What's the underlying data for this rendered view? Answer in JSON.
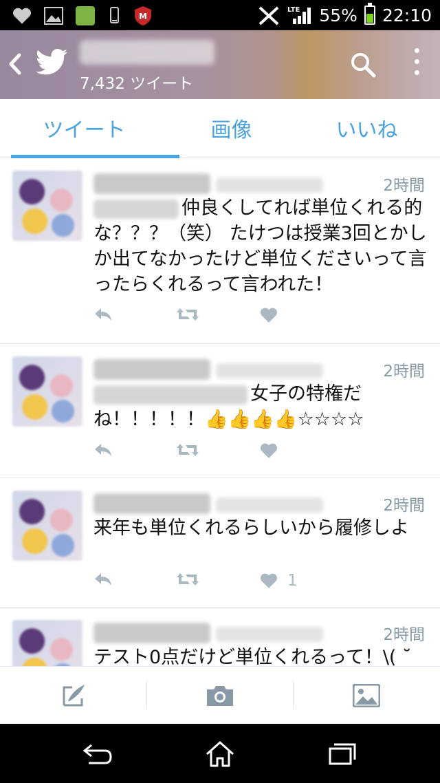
{
  "status_bar": {
    "battery": "55%",
    "time": "22:10",
    "network": "LTE",
    "icons": [
      "heart-icon",
      "gallery-icon",
      "app-icon",
      "phone-icon",
      "mcafee-icon",
      "mute-icon",
      "signal-icon",
      "battery-icon"
    ]
  },
  "header": {
    "tweet_count": "7,432 ツイート"
  },
  "tabs": [
    {
      "label": "ツイート",
      "active": true
    },
    {
      "label": "画像",
      "active": false
    },
    {
      "label": "いいね",
      "active": false
    }
  ],
  "tweets": [
    {
      "time": "2時間",
      "text": "仲良くしてれば単位くれる的な？？？（笑） たけつは授業3回とかしか出てなかったけど単位くださいって言ったらくれるって言われた！",
      "likes": ""
    },
    {
      "time": "2時間",
      "text": "女子の特権だね！！！！！👍👍👍👍☆☆☆☆",
      "likes": ""
    },
    {
      "time": "2時間",
      "text": "来年も単位くれるらしいから履修しよ",
      "likes": "1"
    },
    {
      "time": "2時間",
      "text": "テスト0点だけど単位くれるって！\\( ˘",
      "likes": ""
    }
  ],
  "colors": {
    "accent": "#4aa3df",
    "action_icon": "#aab8c2",
    "meta_text": "#8899a6"
  }
}
